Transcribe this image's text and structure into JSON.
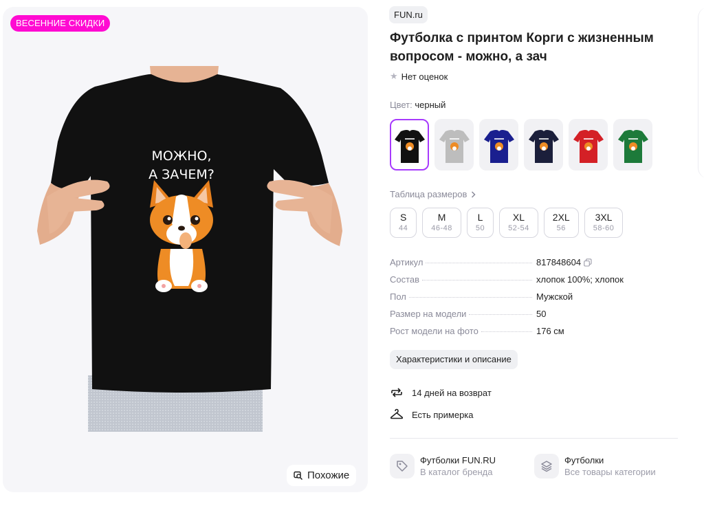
{
  "gallery": {
    "promo_badge": "ВЕСЕННИЕ СКИДКИ",
    "print_line1": "МОЖНО,",
    "print_line2": "А ЗАЧЕМ?",
    "similar_label": "Похожие"
  },
  "product": {
    "brand": "FUN.ru",
    "title": "Футболка с принтом Корги с жизненным вопросом - можно, а зач",
    "rating_text": "Нет оценок",
    "color_label": "Цвет:",
    "color_value": "черный",
    "swatch_colors": [
      "#111111",
      "#bdbdbd",
      "#1a1f8f",
      "#1b1f3b",
      "#d42026",
      "#1d7a3a"
    ],
    "size_table_label": "Таблица размеров",
    "sizes": [
      {
        "name": "S",
        "ru": "44"
      },
      {
        "name": "M",
        "ru": "46-48"
      },
      {
        "name": "L",
        "ru": "50"
      },
      {
        "name": "XL",
        "ru": "52-54"
      },
      {
        "name": "2XL",
        "ru": "56"
      },
      {
        "name": "3XL",
        "ru": "58-60"
      }
    ],
    "specs": [
      {
        "key": "Артикул",
        "value": "817848604"
      },
      {
        "key": "Состав",
        "value": "хлопок 100%; хлопок"
      },
      {
        "key": "Пол",
        "value": "Мужской"
      },
      {
        "key": "Размер на модели",
        "value": "50"
      },
      {
        "key": "Рост модели на фото",
        "value": "176 см"
      }
    ],
    "chars_button": "Характеристики и описание",
    "return_text": "14 дней на возврат",
    "fitting_text": "Есть примерка",
    "brand_link": {
      "title": "Футболки FUN.RU",
      "subtitle": "В каталог бренда"
    },
    "category_link": {
      "title": "Футболки",
      "subtitle": "Все товары категории"
    }
  },
  "colors": {
    "promo": "#ff0bd2",
    "selected_border": "#a73afd",
    "muted_text": "#8a8a99"
  }
}
